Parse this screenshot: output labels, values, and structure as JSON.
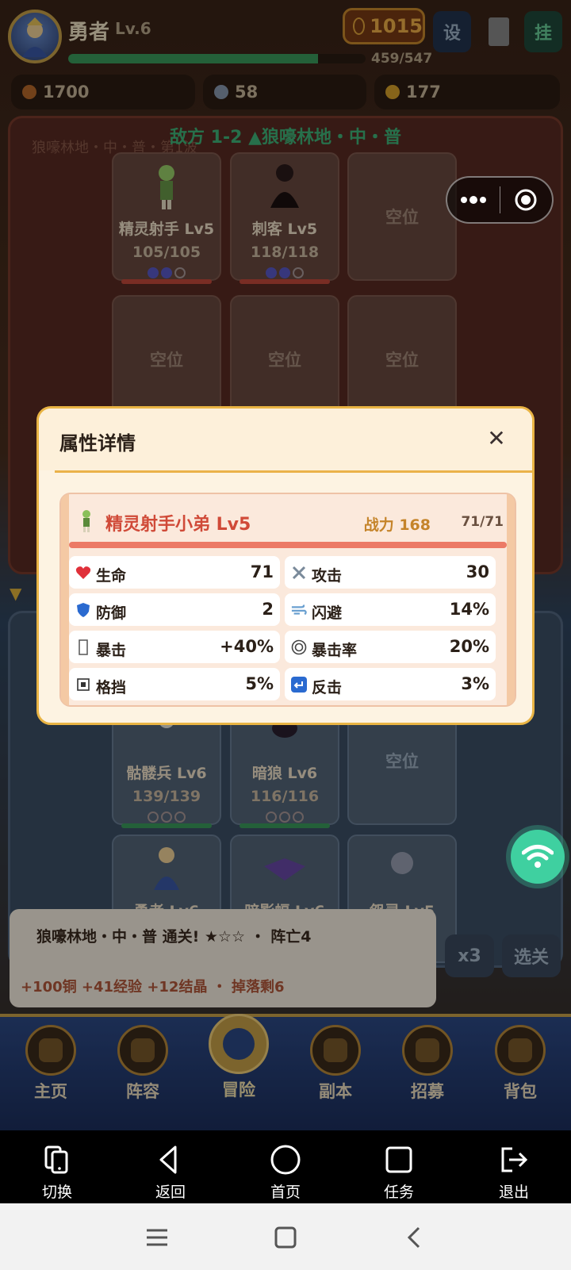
{
  "player": {
    "name": "勇者",
    "level": "Lv.6",
    "xp_text": "459/547",
    "xp_fraction": 0.839,
    "power": "1015"
  },
  "top_buttons": {
    "settings": "设",
    "hang": "挂"
  },
  "resources": [
    {
      "value": "1700",
      "color": "#b86a2a"
    },
    {
      "value": "58",
      "color": "#8a9ab0"
    },
    {
      "value": "177",
      "color": "#d9a22a"
    }
  ],
  "enemy": {
    "stage_title": "敌方 1-2 ▲狼嚎林地・中・普",
    "stage_sub": "狼嚎林地・中・普・第1波",
    "units": [
      {
        "name": "精灵射手 Lv5",
        "hp": "105/105",
        "stars": 2
      },
      {
        "name": "刺客 Lv5",
        "hp": "118/118",
        "stars": 2
      }
    ],
    "empty_label": "空位"
  },
  "ally": {
    "units_row1": [
      {
        "name": "骷髅兵 Lv6",
        "hp": "139/139"
      },
      {
        "name": "暗狼 Lv6",
        "hp": "116/116"
      }
    ],
    "units_row2": [
      {
        "name": "勇者 Lv6"
      },
      {
        "name": "暗影蝠 Lv6"
      },
      {
        "name": "怨灵 Lv5"
      }
    ],
    "empty_label": "空位"
  },
  "result": {
    "line1": "狼嚎林地・中・普 通关! ★☆☆ ・ 阵亡4",
    "line2": "+100铜 +41经验 +12结晶 ・ 掉落剩6",
    "speed_button": "x3",
    "select_button": "选关"
  },
  "nav": [
    "主页",
    "阵容",
    "冒险",
    "副本",
    "招募",
    "背包"
  ],
  "modal": {
    "title": "属性详情",
    "unit_title": "精灵射手小弟 Lv5",
    "power": "战力 168",
    "hp": "71/71",
    "stats": [
      {
        "icon": "heart-icon",
        "label": "生命",
        "value": "71"
      },
      {
        "icon": "swords-icon",
        "label": "攻击",
        "value": "30"
      },
      {
        "icon": "shield-icon",
        "label": "防御",
        "value": "2"
      },
      {
        "icon": "wind-icon",
        "label": "闪避",
        "value": "14%"
      },
      {
        "icon": "missing-glyph-icon",
        "label": "暴击",
        "value": "+40%"
      },
      {
        "icon": "target-icon",
        "label": "暴击率",
        "value": "20%"
      },
      {
        "icon": "block-icon",
        "label": "格挡",
        "value": "5%"
      },
      {
        "icon": "counter-icon",
        "label": "反击",
        "value": "3%"
      }
    ]
  },
  "system_toolbar": [
    "切换",
    "返回",
    "首页",
    "任务",
    "退出"
  ]
}
